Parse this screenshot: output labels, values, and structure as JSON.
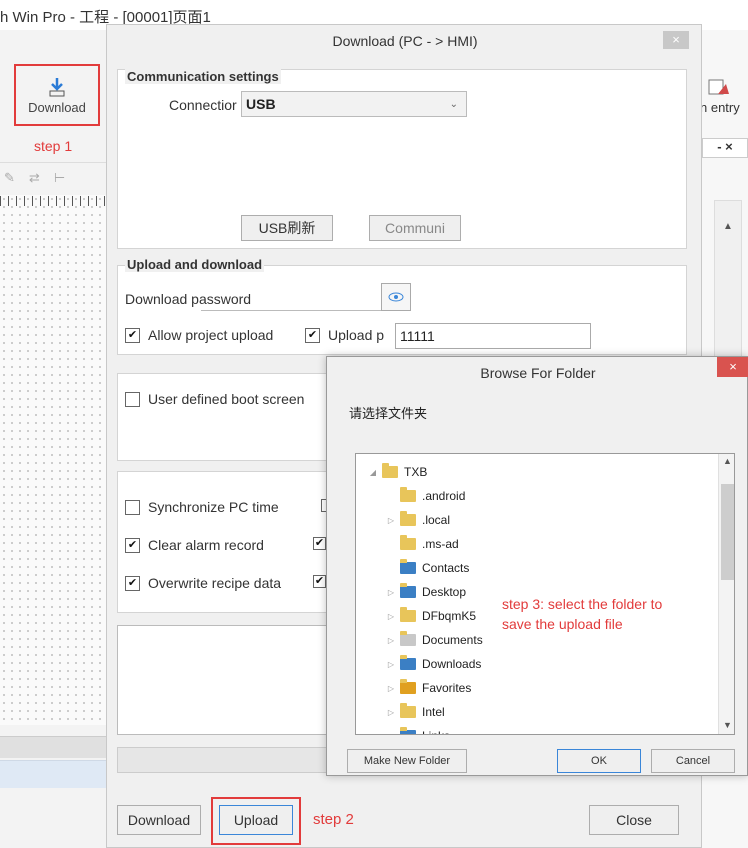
{
  "app": {
    "title": "h Win Pro - 工程 - [00001]页面1",
    "toolbar": {
      "download_label": "Download",
      "right_label": "n entry"
    },
    "annotation_step1": "step 1",
    "tab_close": "- ×"
  },
  "dialog": {
    "title": "Download (PC - > HMI)",
    "close": "×",
    "comm": {
      "group_label": "Communication settings",
      "connection_label": "Connectior",
      "connection_value": "USB",
      "usb_refresh_label": "USB刷新",
      "communi_label": "Communi"
    },
    "upload_download": {
      "group_label": "Upload and download",
      "password_label": "Download password",
      "allow_upload_label": "Allow project upload",
      "upload_p_label": "Upload p",
      "upload_p_value": "11111"
    },
    "boot_screen_label": "User defined boot screen",
    "options": {
      "sync_pc_time": "Synchronize PC time",
      "clear_alarm": "Clear alarm record",
      "overwrite_recipe": "Overwrite recipe data"
    },
    "buttons": {
      "download": "Download",
      "upload": "Upload",
      "close": "Close"
    },
    "annotation_step2": "step 2"
  },
  "browse": {
    "title": "Browse For Folder",
    "close": "×",
    "prompt": "请选择文件夹",
    "tree": [
      {
        "label": "TXB",
        "level": 0,
        "expander": "◢"
      },
      {
        "label": ".android",
        "level": 1,
        "expander": ""
      },
      {
        "label": ".local",
        "level": 1,
        "expander": "▷"
      },
      {
        "label": ".ms-ad",
        "level": 1,
        "expander": ""
      },
      {
        "label": "Contacts",
        "level": 1,
        "expander": ""
      },
      {
        "label": "Desktop",
        "level": 1,
        "expander": "▷"
      },
      {
        "label": "DFbqmK5",
        "level": 1,
        "expander": "▷"
      },
      {
        "label": "Documents",
        "level": 1,
        "expander": "▷"
      },
      {
        "label": "Downloads",
        "level": 1,
        "expander": "▷"
      },
      {
        "label": "Favorites",
        "level": 1,
        "expander": "▷"
      },
      {
        "label": "Intel",
        "level": 1,
        "expander": "▷"
      },
      {
        "label": "Links",
        "level": 1,
        "expander": ""
      }
    ],
    "annotation_step3_line1": "step 3: select the folder to",
    "annotation_step3_line2": "save the upload file",
    "make_new_folder": "Make New Folder",
    "ok": "OK",
    "cancel": "Cancel"
  },
  "colors": {
    "annotation_red": "#e23b3b",
    "close_red": "#d9534f",
    "download_arrow": "#2a7bd6"
  }
}
